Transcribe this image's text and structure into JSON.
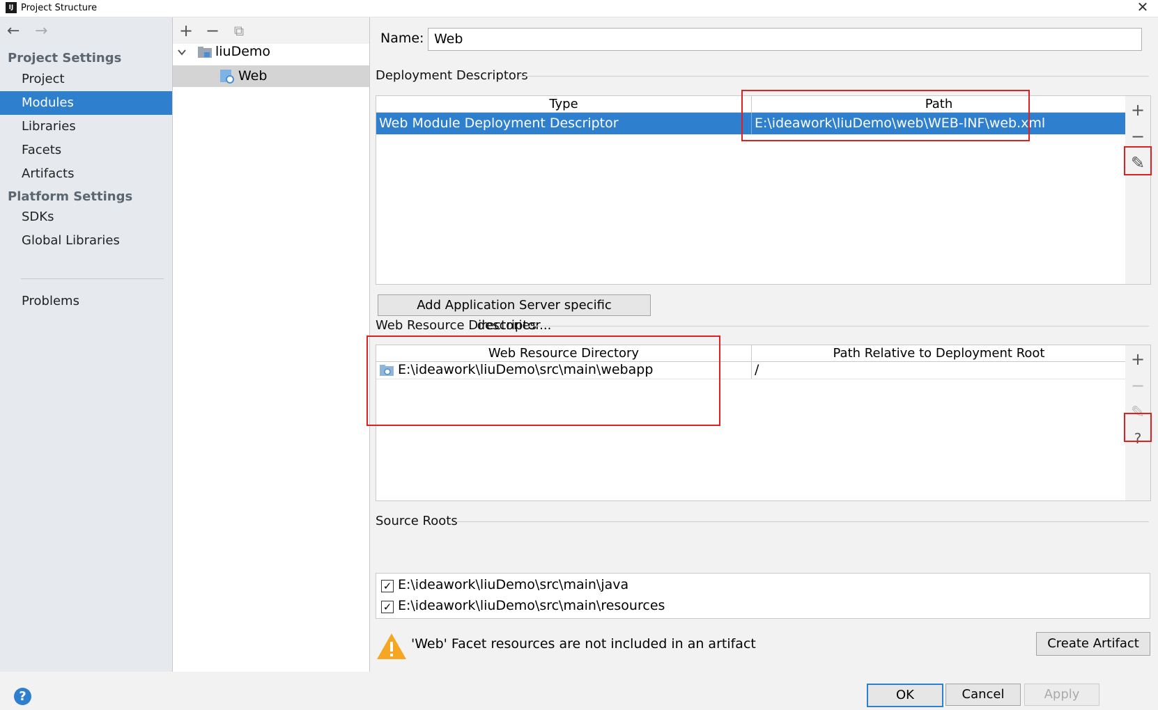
{
  "window": {
    "title": "Project Structure",
    "app_icon": "IJ",
    "close": "✕"
  },
  "nav": {
    "back": "←",
    "forward": "→",
    "project_settings": "Project Settings",
    "items_project": [
      "Project",
      "Modules",
      "Libraries",
      "Facets",
      "Artifacts"
    ],
    "platform_settings": "Platform Settings",
    "items_platform": [
      "SDKs",
      "Global Libraries"
    ],
    "problems": "Problems",
    "selected": "Modules"
  },
  "tree": {
    "toolbar": {
      "add": "+",
      "remove": "−",
      "copy": "⧉"
    },
    "root": "liuDemo",
    "child": "Web"
  },
  "facet": {
    "name_label": "Name:",
    "name_value": "Web",
    "deployment": {
      "title": "Deployment Descriptors",
      "columns": [
        "Type",
        "Path"
      ],
      "rows": [
        {
          "type": "Web Module Deployment Descriptor",
          "path": "E:\\ideawork\\liuDemo\\web\\WEB-INF\\web.xml"
        }
      ],
      "add_server_button": "Add Application Server specific descriptor..."
    },
    "web_resources": {
      "title": "Web Resource Directories",
      "columns": [
        "Web Resource Directory",
        "Path Relative to Deployment Root"
      ],
      "rows": [
        {
          "dir": "E:\\ideawork\\liuDemo\\src\\main\\webapp",
          "relative": "/"
        }
      ]
    },
    "source_roots": {
      "title": "Source Roots",
      "items": [
        "E:\\ideawork\\liuDemo\\src\\main\\java",
        "E:\\ideawork\\liuDemo\\src\\main\\resources"
      ]
    },
    "warning": "'Web' Facet resources are not included in an artifact",
    "create_artifact": "Create Artifact",
    "side_tools": {
      "add": "+",
      "remove": "−",
      "edit": "✎",
      "help": "?"
    }
  },
  "footer": {
    "ok": "OK",
    "cancel": "Cancel",
    "apply": "Apply",
    "help": "?"
  },
  "colors": {
    "selection": "#2f7fcf",
    "highlight_box": "#e02020",
    "warning": "#f5a623"
  }
}
